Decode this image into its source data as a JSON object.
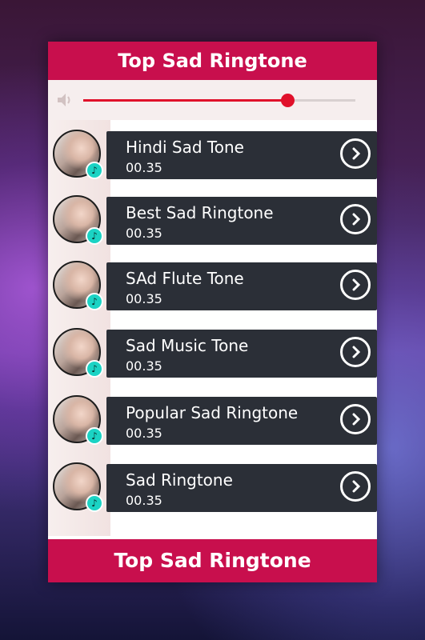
{
  "header": {
    "title": "Top Sad Ringtone"
  },
  "footer": {
    "title": "Top Sad Ringtone"
  },
  "volume": {
    "level": 0.75,
    "icon": "speaker-icon",
    "accent": "#e0102a"
  },
  "colors": {
    "brand": "#c80f4d",
    "row_bg": "#2b2f37"
  },
  "ringtones": [
    {
      "title": "Hindi Sad Tone",
      "duration": "00.35"
    },
    {
      "title": "Best Sad Ringtone",
      "duration": "00.35"
    },
    {
      "title": "SAd Flute Tone",
      "duration": "00.35"
    },
    {
      "title": "Sad Music Tone",
      "duration": "00.35"
    },
    {
      "title": "Popular Sad Ringtone",
      "duration": "00.35"
    },
    {
      "title": "Sad Ringtone",
      "duration": "00.35"
    }
  ]
}
